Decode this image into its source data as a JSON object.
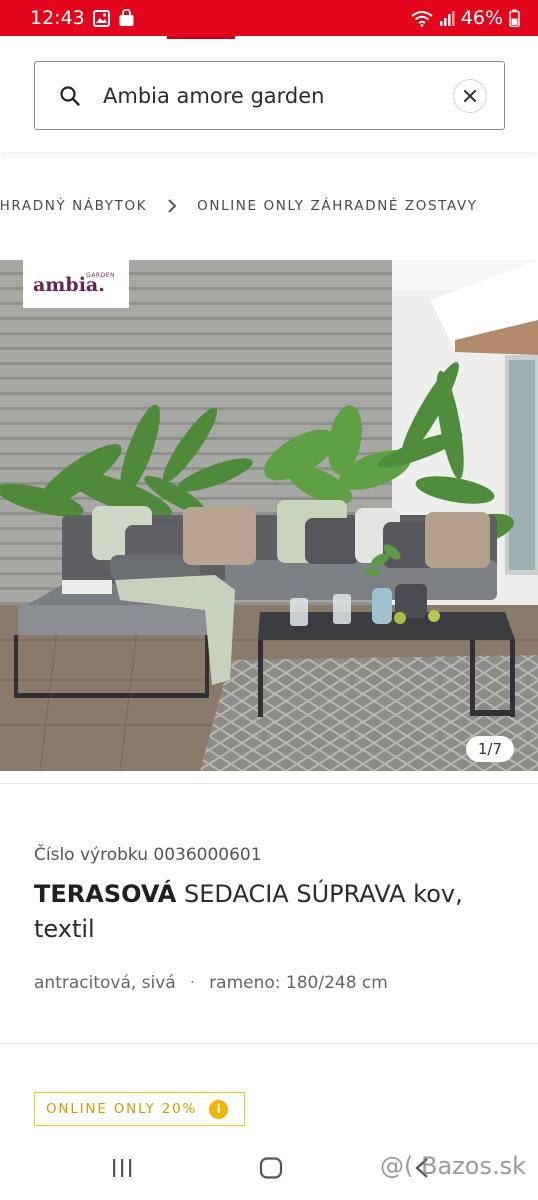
{
  "status_bar": {
    "time": "12:43",
    "battery": "46%"
  },
  "search": {
    "value": "Ambia amore garden",
    "icon": "search-icon",
    "clear_icon": "close-icon"
  },
  "breadcrumb": {
    "items": [
      "ZÁHRADNÝ NÁBYTOK",
      "ONLINE ONLY ZÁHRADNÉ ZOSTAVY"
    ]
  },
  "gallery": {
    "brand_name": "ambia.",
    "brand_sub": "GARDEN",
    "counter": "1/7"
  },
  "product": {
    "number_label": "Číslo výrobku 0036000601",
    "title_bold": "TERASOVÁ",
    "title_rest": " SEDACIA SÚPRAVA kov, textil",
    "color": "antracitová, sivá",
    "separator": "·",
    "dimensions": "rameno: 180/248 cm"
  },
  "promo": {
    "label": "ONLINE ONLY 20%",
    "info": "i",
    "accent": "#f0c419"
  },
  "watermark": "@( Bazos.sk",
  "colors": {
    "brand_red": "#e3051b",
    "brand_purple": "#6b2350"
  }
}
